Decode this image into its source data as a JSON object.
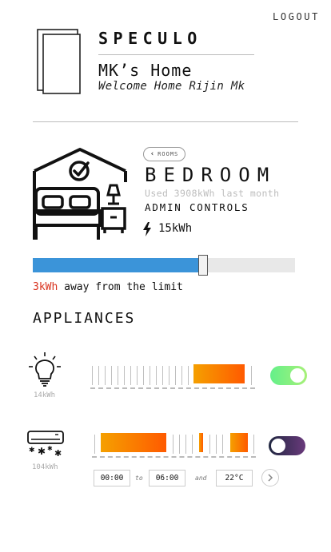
{
  "header": {
    "logout_label": "LOGOUT",
    "brand": "SPECULO",
    "home_title": "MK’s Home",
    "welcome": "Welcome Home Rijin Mk"
  },
  "room": {
    "back_label": "ROOMS",
    "name": "BEDROOM",
    "usage_text": "Used 3908kWh last month",
    "admin_label": "ADMIN CONTROLS",
    "power": "15kWh",
    "limit_remaining": "3kWh",
    "limit_suffix": " away from the limit",
    "usage_fraction": 0.648
  },
  "appliances": {
    "title": "APPLIANCES",
    "items": [
      {
        "name": "light",
        "icon": "light-bulb-icon",
        "kwh": "14kWh",
        "enabled": true,
        "toggle_color": "#64f08a"
      },
      {
        "name": "air-conditioner",
        "icon": "air-conditioner-icon",
        "kwh": "104kWh",
        "enabled": false,
        "toggle_color": "#3a3060",
        "schedule": {
          "from": "00:00",
          "to_label": "to",
          "to": "06:00",
          "and_label": "and",
          "temperature": "22°C"
        }
      }
    ]
  },
  "colors": {
    "accent_blue": "#3b94d9",
    "limit_red": "#d9331f",
    "gradient_start": "#f5a000",
    "gradient_end": "#ff5a00"
  }
}
